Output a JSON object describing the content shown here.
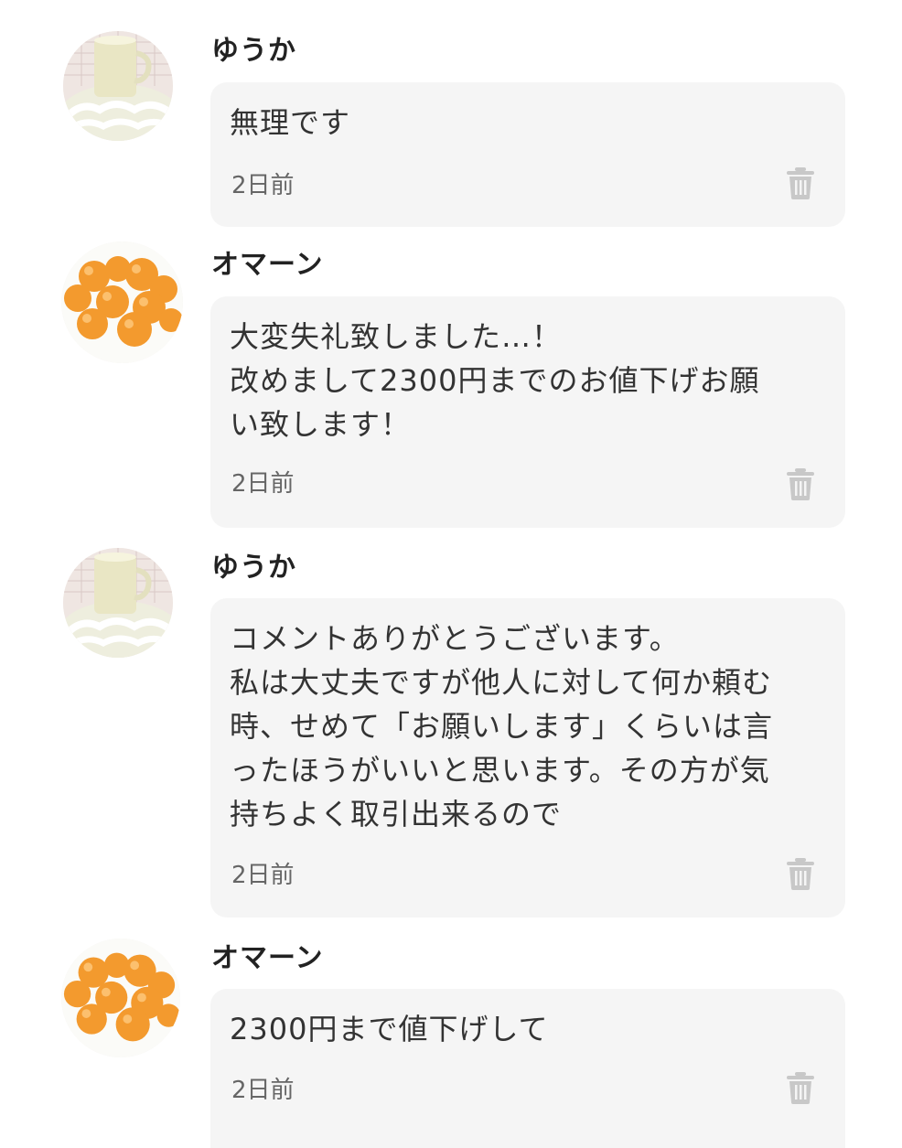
{
  "comments": [
    {
      "user": "ゆうか",
      "avatar": "teacup-avatar",
      "message": "無理です",
      "time": "2日前"
    },
    {
      "user": "オマーン",
      "avatar": "oranges-avatar",
      "message": "大変失礼致しました…！\n改めまして2300円までのお値下げお願\nい致します！",
      "time": "2日前"
    },
    {
      "user": "ゆうか",
      "avatar": "teacup-avatar",
      "message": "コメントありがとうございます。\n私は大丈夫ですが他人に対して何か頼む\n時、せめて「お願いします」くらいは言\nったほうがいいと思います。その方が気\n持ちよく取引出来るので",
      "time": "2日前"
    },
    {
      "user": "オマーン",
      "avatar": "oranges-avatar",
      "message": "2300円まで値下げして",
      "time": "2日前"
    }
  ],
  "colors": {
    "bubble_bg": "#f5f5f5",
    "name": "#222222",
    "message": "#333333",
    "time": "#666666",
    "trash_icon": "#c8c8c8",
    "orange": "#f39a2e"
  },
  "icons": {
    "delete": "trash-icon"
  }
}
